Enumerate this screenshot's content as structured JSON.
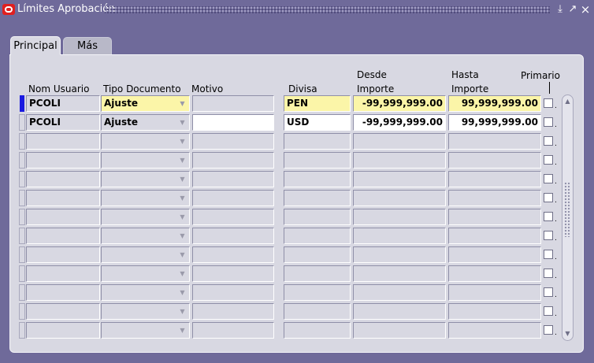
{
  "window": {
    "title": "Límites Aprobación",
    "buttons": {
      "minimize": "⤓",
      "restore": "↗",
      "close": "×"
    }
  },
  "tabs": [
    {
      "label": "Principal",
      "active": true
    },
    {
      "label": "Más",
      "active": false
    }
  ],
  "table": {
    "headers": {
      "user": "Nom Usuario",
      "doc_type": "Tipo Documento",
      "reason": "Motivo",
      "currency": "Divisa",
      "from_1": "Desde",
      "from_2": "Importe",
      "to_1": "Hasta",
      "to_2": "Importe",
      "primary": "Primario"
    },
    "rows": [
      {
        "user": "PCOLI",
        "doc_type": "Ajuste",
        "reason": "",
        "currency": "PEN",
        "from": "-99,999,999.00",
        "to": "99,999,999.00",
        "primary": false
      },
      {
        "user": "PCOLI",
        "doc_type": "Ajuste",
        "reason": "",
        "currency": "USD",
        "from": "-99,999,999.00",
        "to": "99,999,999.00",
        "primary": false
      }
    ],
    "empty_row_count": 11
  },
  "colors": {
    "window_bg": "#6f6a9a",
    "panel_bg": "#d8d8e2",
    "required_field": "#fbf5a8",
    "current_record": "#1a1ae0"
  },
  "icons": {
    "app": "oracle-logo-icon",
    "dropdown": "chevron-down-icon",
    "scroll_up": "arrow-up-icon",
    "scroll_down": "arrow-down-icon"
  }
}
